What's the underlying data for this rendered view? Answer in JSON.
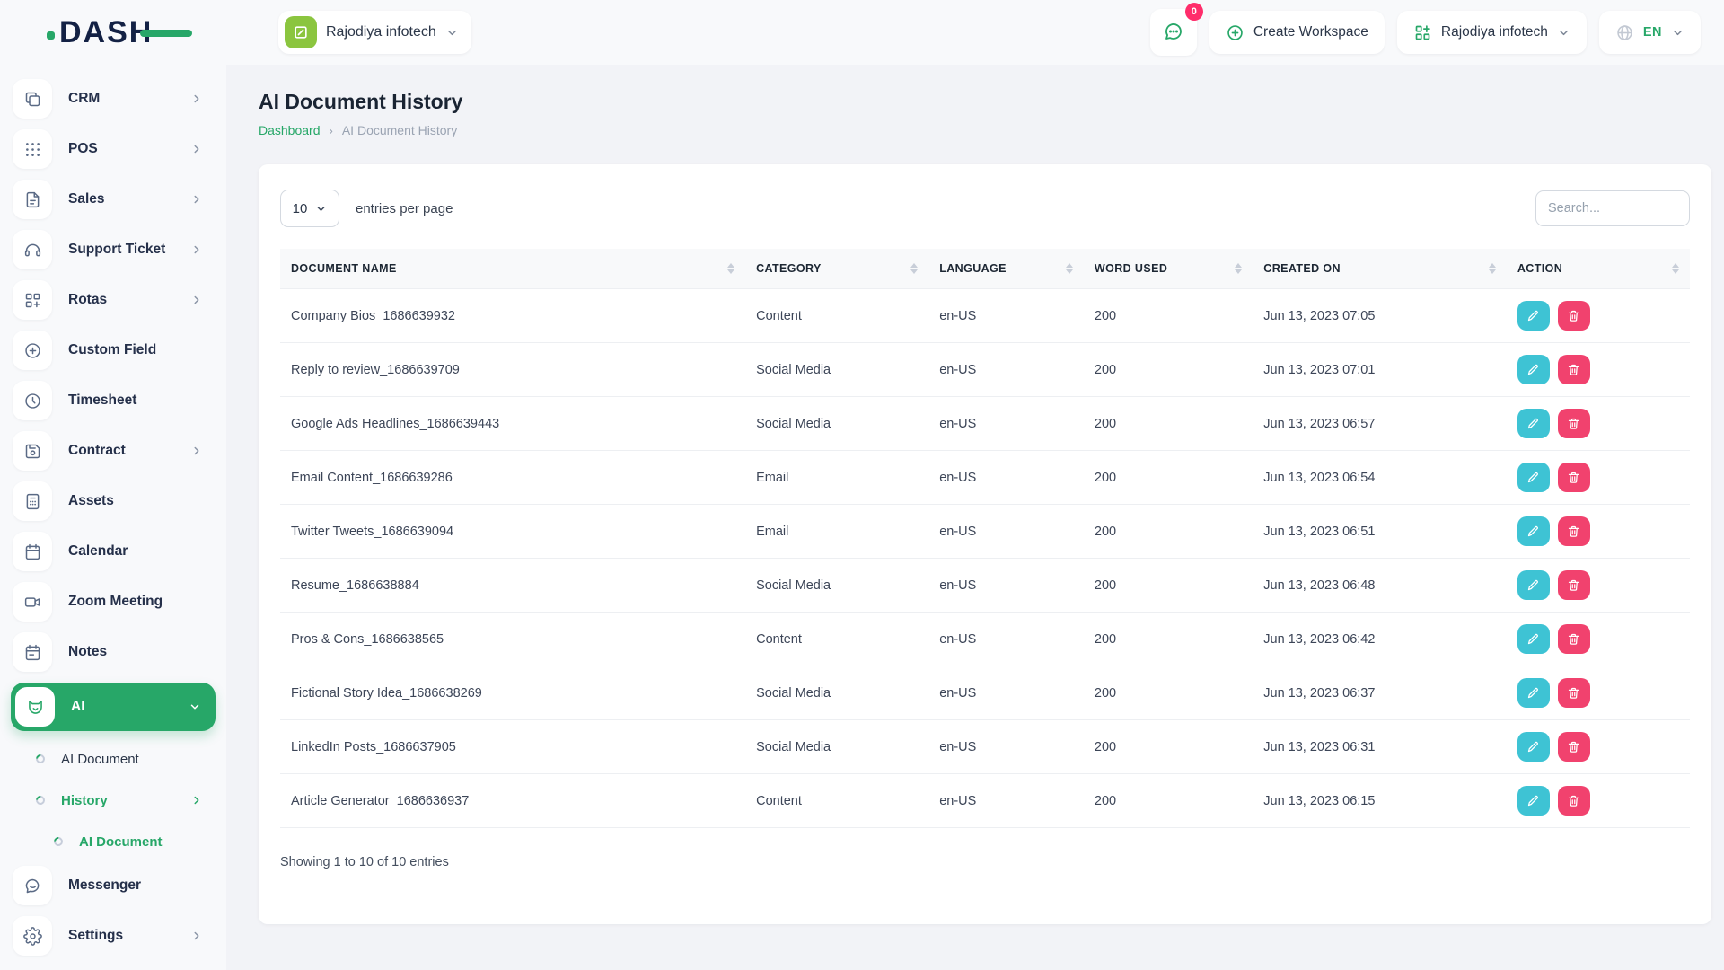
{
  "colors": {
    "accent_green": "#27a768",
    "avatar_green": "#8bc53f",
    "edit_cyan": "#3ec3d4",
    "delete_pink": "#f1426e",
    "badge_red": "#ff2d6b"
  },
  "header": {
    "logo": "DASH",
    "workspace_switcher": "Rajodiya infotech",
    "messages_badge": "0",
    "create_workspace": "Create Workspace",
    "account_workspace": "Rajodiya infotech",
    "language": "EN"
  },
  "sidebar": {
    "items": [
      {
        "label": "CRM",
        "icon": "crm-icon",
        "type": "top",
        "chevron": "right"
      },
      {
        "label": "POS",
        "icon": "pos-icon",
        "type": "top",
        "chevron": "right"
      },
      {
        "label": "Sales",
        "icon": "sales-icon",
        "type": "top",
        "chevron": "right"
      },
      {
        "label": "Support Ticket",
        "icon": "support-ticket-icon",
        "type": "top",
        "chevron": "right"
      },
      {
        "label": "Rotas",
        "icon": "rotas-icon",
        "type": "top",
        "chevron": "right"
      },
      {
        "label": "Custom Field",
        "icon": "custom-field-icon",
        "type": "top"
      },
      {
        "label": "Timesheet",
        "icon": "timesheet-icon",
        "type": "top"
      },
      {
        "label": "Contract",
        "icon": "contract-icon",
        "type": "top",
        "chevron": "right"
      },
      {
        "label": "Assets",
        "icon": "assets-icon",
        "type": "top"
      },
      {
        "label": "Calendar",
        "icon": "calendar-icon",
        "type": "top"
      },
      {
        "label": "Zoom Meeting",
        "icon": "zoom-meeting-icon",
        "type": "top"
      },
      {
        "label": "Notes",
        "icon": "notes-icon",
        "type": "top"
      },
      {
        "label": "AI",
        "icon": "ai-icon",
        "type": "top",
        "chevron": "down",
        "active": true
      },
      {
        "label": "AI Document",
        "type": "sub",
        "level": 1
      },
      {
        "label": "History",
        "type": "sub",
        "level": 1,
        "chevron": "right",
        "highlight": true
      },
      {
        "label": "AI Document",
        "type": "sub",
        "level": 2,
        "highlight": true
      },
      {
        "label": "Messenger",
        "icon": "messenger-icon",
        "type": "top"
      },
      {
        "label": "Settings",
        "icon": "settings-icon",
        "type": "top",
        "chevron": "right"
      }
    ]
  },
  "page": {
    "title": "AI Document History",
    "breadcrumb_home": "Dashboard",
    "breadcrumb_current": "AI Document History"
  },
  "table": {
    "page_size": "10",
    "entries_label": "entries per page",
    "search_placeholder": "Search...",
    "columns": [
      "DOCUMENT NAME",
      "CATEGORY",
      "LANGUAGE",
      "WORD USED",
      "CREATED ON",
      "ACTION"
    ],
    "rows": [
      {
        "name": "Company Bios_1686639932",
        "category": "Content",
        "language": "en-US",
        "words": "200",
        "created": "Jun 13, 2023 07:05"
      },
      {
        "name": "Reply to review_1686639709",
        "category": "Social Media",
        "language": "en-US",
        "words": "200",
        "created": "Jun 13, 2023 07:01"
      },
      {
        "name": "Google Ads Headlines_1686639443",
        "category": "Social Media",
        "language": "en-US",
        "words": "200",
        "created": "Jun 13, 2023 06:57"
      },
      {
        "name": "Email Content_1686639286",
        "category": "Email",
        "language": "en-US",
        "words": "200",
        "created": "Jun 13, 2023 06:54"
      },
      {
        "name": "Twitter Tweets_1686639094",
        "category": "Email",
        "language": "en-US",
        "words": "200",
        "created": "Jun 13, 2023 06:51"
      },
      {
        "name": "Resume_1686638884",
        "category": "Social Media",
        "language": "en-US",
        "words": "200",
        "created": "Jun 13, 2023 06:48"
      },
      {
        "name": "Pros & Cons_1686638565",
        "category": "Content",
        "language": "en-US",
        "words": "200",
        "created": "Jun 13, 2023 06:42"
      },
      {
        "name": "Fictional Story Idea_1686638269",
        "category": "Social Media",
        "language": "en-US",
        "words": "200",
        "created": "Jun 13, 2023 06:37"
      },
      {
        "name": "LinkedIn Posts_1686637905",
        "category": "Social Media",
        "language": "en-US",
        "words": "200",
        "created": "Jun 13, 2023 06:31"
      },
      {
        "name": "Article Generator_1686636937",
        "category": "Content",
        "language": "en-US",
        "words": "200",
        "created": "Jun 13, 2023 06:15"
      }
    ],
    "footer": "Showing 1 to 10 of 10 entries"
  }
}
